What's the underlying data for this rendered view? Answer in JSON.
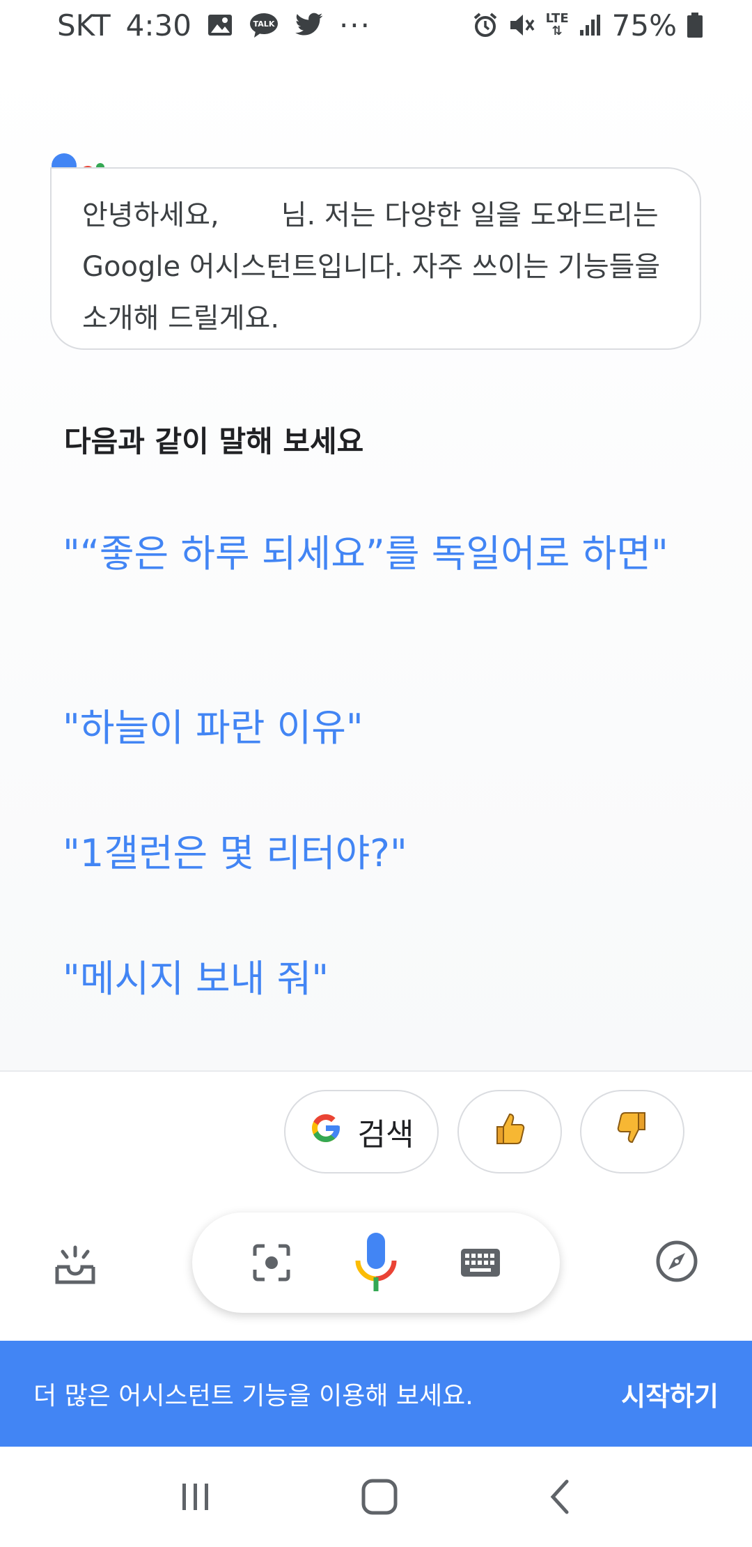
{
  "status_bar": {
    "carrier": "SKT",
    "time": "4:30",
    "icons_left": [
      "gallery-icon",
      "kakaotalk-icon",
      "twitter-icon",
      "more-notifications-icon"
    ],
    "talk_badge": "TALK",
    "more": "···",
    "network": "LTE",
    "battery": "75%"
  },
  "assistant": {
    "greeting": "안녕하세요,       님. 저는 다양한 일을 도와드리는 Google 어시스턴트입니다. 자주 쓰이는 기능들을 소개해 드릴게요.",
    "logo_colors": {
      "blue": "#4285f4",
      "red": "#ea4335",
      "yellow": "#fbbc05",
      "green": "#34a853"
    }
  },
  "suggestions_section": {
    "title": "다음과 같이 말해 보세요",
    "items": [
      {
        "label": "\"“좋은 하루 되세요”를 독일어로 하면\""
      },
      {
        "label": "\"하늘이 파란 이유\""
      },
      {
        "label": "\"1갤런은 몇 리터야?\""
      },
      {
        "label": "\"메시지 보내 줘\""
      }
    ]
  },
  "chips": {
    "search_label": "검색"
  },
  "bottom_bar": {
    "icons": [
      "updates-icon",
      "lens-icon",
      "mic-icon",
      "keyboard-icon",
      "explore-icon"
    ]
  },
  "promo": {
    "text": "더 많은 어시스턴트 기능을 이용해 보세요.",
    "action": "시작하기",
    "color": "#4285f4"
  },
  "nav_bar": {
    "icons": [
      "recent-apps-icon",
      "home-icon",
      "back-icon"
    ]
  }
}
